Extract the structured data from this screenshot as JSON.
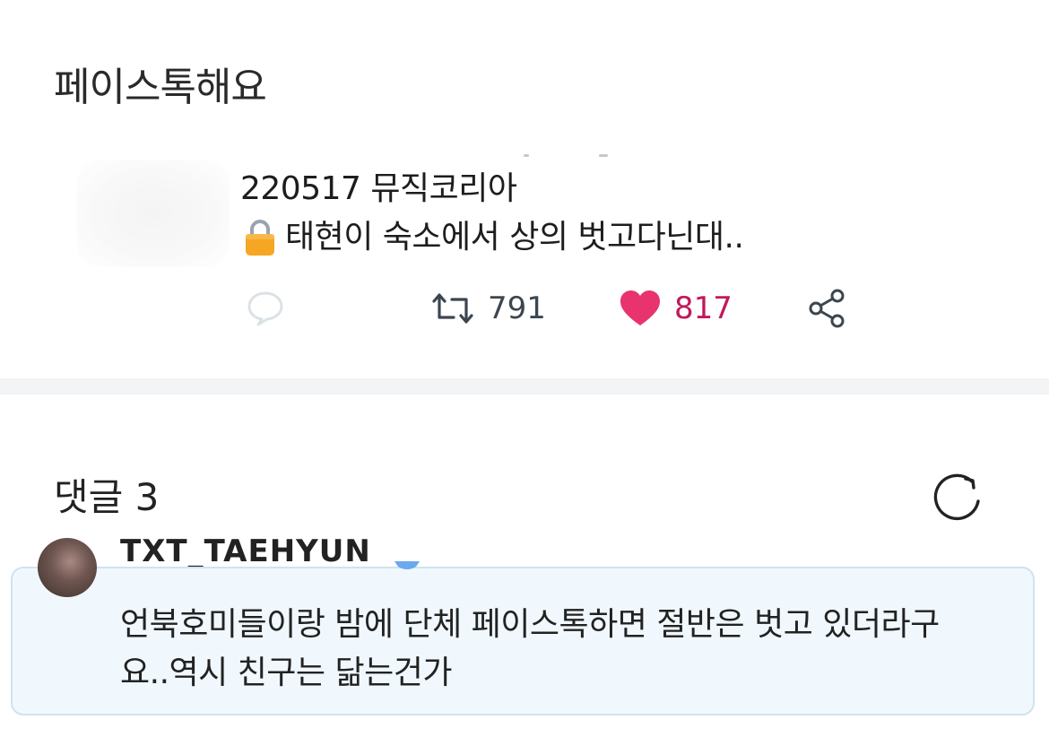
{
  "post": {
    "title": "페이스톡해요",
    "tweet": {
      "line1": "220517 뮤직코리아",
      "line2": "태현이 숙소에서 상의 벗고다닌대..",
      "lock_icon": "lock-icon",
      "retweets": "791",
      "likes": "817",
      "like_color": "#e8336f"
    }
  },
  "comments": {
    "title": "댓글 3",
    "items": [
      {
        "username": "TXT_TAEHYUN",
        "verified": true,
        "text": "언북호미들이랑 밤에 단체 페이스톡하면 절반은 벗고 있더라구요..역시 친구는 닮는건가"
      }
    ]
  },
  "colors": {
    "comment_bg": "#f0f8fd",
    "comment_border": "#cfe3ef",
    "divider": "#f2f4f6"
  }
}
